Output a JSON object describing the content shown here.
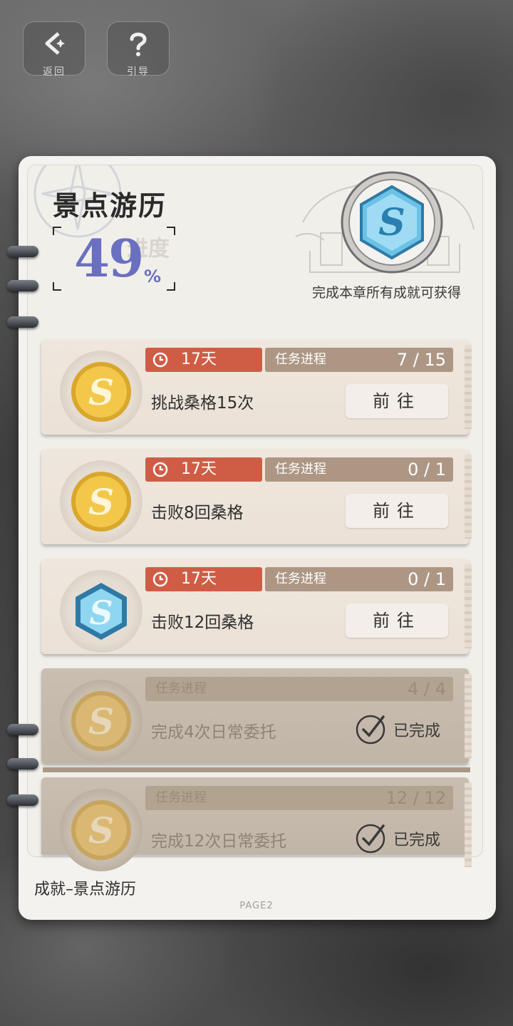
{
  "header": {
    "back_label": "返回",
    "guide_label": "引导"
  },
  "book": {
    "title": "景点游历",
    "progress_label": "进度",
    "progress_value": "49",
    "progress_unit": "%",
    "reward_text": "完成本章所有成就可获得",
    "footer_title": "成就–景点游历",
    "page_label": "PAGE2"
  },
  "tasks": [
    {
      "timer": "17天",
      "progress_label": "任务进程",
      "progress": "7 / 15",
      "desc": "挑战桑格15次",
      "action": "前往",
      "coin": "gold"
    },
    {
      "timer": "17天",
      "progress_label": "任务进程",
      "progress": "0 / 1",
      "desc": "击败8回桑格",
      "action": "前往",
      "coin": "gold"
    },
    {
      "timer": "17天",
      "progress_label": "任务进程",
      "progress": "0 / 1",
      "desc": "击败12回桑格",
      "action": "前往",
      "coin": "blue"
    },
    {
      "progress_label": "任务进程",
      "progress": "4 / 4",
      "desc": "完成4次日常委托",
      "status": "已完成",
      "coin": "gold"
    },
    {
      "progress_label": "任务进程",
      "progress": "12 / 12",
      "desc": "完成12次日常委托",
      "status": "已完成",
      "coin": "gold"
    }
  ],
  "colors": {
    "timer_bg": "#cf5d46",
    "track_bg": "#ad9784",
    "progress_text": "#6b6fc0"
  }
}
